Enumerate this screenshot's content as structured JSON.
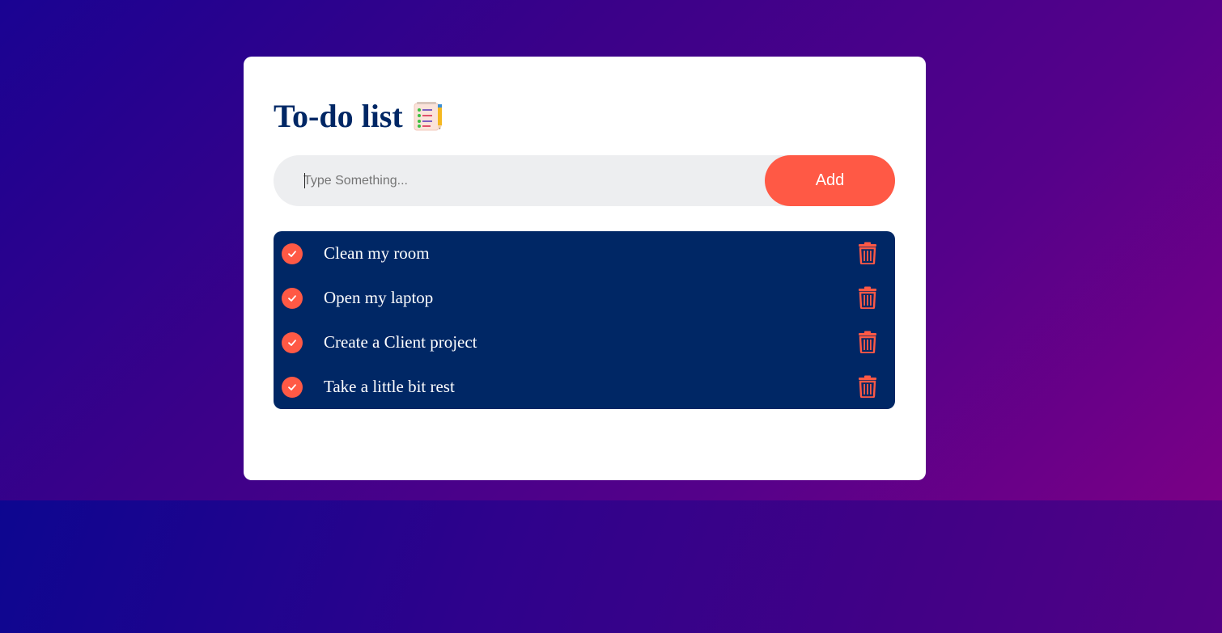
{
  "app": {
    "title": "To-do list",
    "title_icon": "notepad-checklist-icon"
  },
  "input": {
    "placeholder": "Type Something...",
    "value": ""
  },
  "add_button": {
    "label": "Add"
  },
  "tasks": [
    {
      "text": "Clean my room",
      "checked": true
    },
    {
      "text": "Open my laptop",
      "checked": true
    },
    {
      "text": "Create a Client project",
      "checked": true
    },
    {
      "text": "Take a little bit rest",
      "checked": true
    }
  ],
  "colors": {
    "accent": "#ff5945",
    "navy": "#002765",
    "card": "#ffffff",
    "input_bg": "#edeef0"
  },
  "icons": {
    "check": "check-circle-icon",
    "delete": "trash-icon"
  }
}
